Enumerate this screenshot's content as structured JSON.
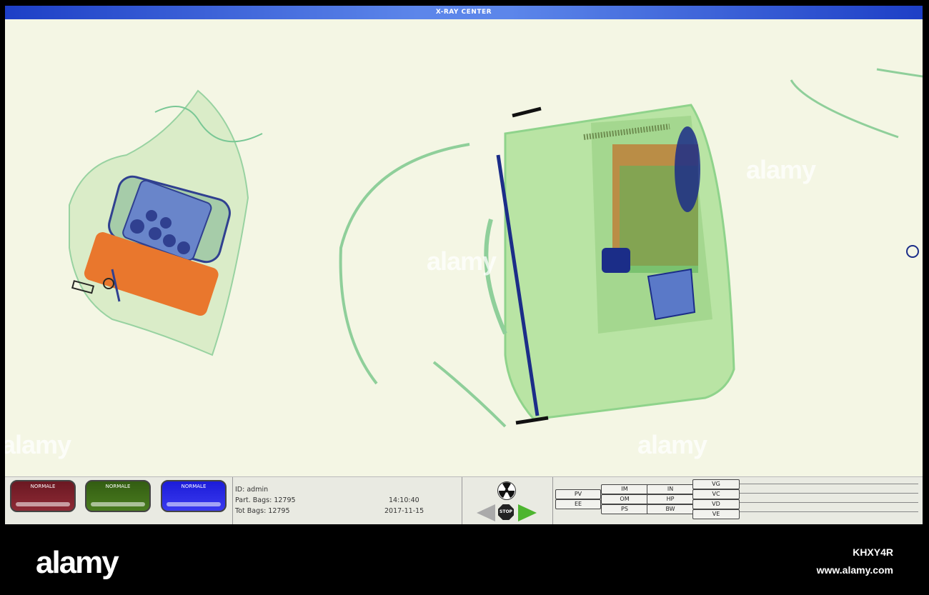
{
  "window": {
    "title": "X-RAY CENTER"
  },
  "watermarks": [
    "alamy",
    "alamy",
    "alamy",
    "alamy"
  ],
  "status_buttons": [
    {
      "label": "NORMALE",
      "color": "#8e2a35"
    },
    {
      "label": "NORMALE",
      "color": "#4a7c1f"
    },
    {
      "label": "NORMALE",
      "color": "#3a3af0"
    }
  ],
  "info": {
    "id": "ID: admin",
    "part_bags": "Part. Bags: 12795",
    "tot_bags": "Tot Bags: 12795",
    "time": "14:10:40",
    "date": "2017-11-15"
  },
  "controls": {
    "stop_label": "STOP",
    "radiation_icon": "radiation-icon",
    "left_icon": "arrow-left-icon",
    "right_icon": "arrow-right-icon"
  },
  "function_keys": {
    "col1": [
      "PV",
      "EE"
    ],
    "col2": [
      "IM",
      "OM",
      "PS"
    ],
    "col3": [
      "IN",
      "HP",
      "BW"
    ],
    "col4": [
      "VG",
      "VC",
      "VD",
      "VE"
    ]
  },
  "footer": {
    "logo": "alamy",
    "image_id": "KHXY4R",
    "site": "www.alamy.com"
  }
}
